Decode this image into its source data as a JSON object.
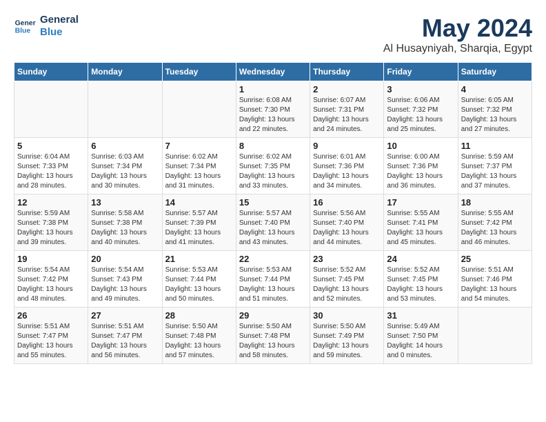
{
  "logo": {
    "line1": "General",
    "line2": "Blue"
  },
  "title": "May 2024",
  "subtitle": "Al Husayniyah, Sharqia, Egypt",
  "days_of_week": [
    "Sunday",
    "Monday",
    "Tuesday",
    "Wednesday",
    "Thursday",
    "Friday",
    "Saturday"
  ],
  "weeks": [
    [
      {
        "day": "",
        "sunrise": "",
        "sunset": "",
        "daylight": ""
      },
      {
        "day": "",
        "sunrise": "",
        "sunset": "",
        "daylight": ""
      },
      {
        "day": "",
        "sunrise": "",
        "sunset": "",
        "daylight": ""
      },
      {
        "day": "1",
        "sunrise": "Sunrise: 6:08 AM",
        "sunset": "Sunset: 7:30 PM",
        "daylight": "Daylight: 13 hours and 22 minutes."
      },
      {
        "day": "2",
        "sunrise": "Sunrise: 6:07 AM",
        "sunset": "Sunset: 7:31 PM",
        "daylight": "Daylight: 13 hours and 24 minutes."
      },
      {
        "day": "3",
        "sunrise": "Sunrise: 6:06 AM",
        "sunset": "Sunset: 7:32 PM",
        "daylight": "Daylight: 13 hours and 25 minutes."
      },
      {
        "day": "4",
        "sunrise": "Sunrise: 6:05 AM",
        "sunset": "Sunset: 7:32 PM",
        "daylight": "Daylight: 13 hours and 27 minutes."
      }
    ],
    [
      {
        "day": "5",
        "sunrise": "Sunrise: 6:04 AM",
        "sunset": "Sunset: 7:33 PM",
        "daylight": "Daylight: 13 hours and 28 minutes."
      },
      {
        "day": "6",
        "sunrise": "Sunrise: 6:03 AM",
        "sunset": "Sunset: 7:34 PM",
        "daylight": "Daylight: 13 hours and 30 minutes."
      },
      {
        "day": "7",
        "sunrise": "Sunrise: 6:02 AM",
        "sunset": "Sunset: 7:34 PM",
        "daylight": "Daylight: 13 hours and 31 minutes."
      },
      {
        "day": "8",
        "sunrise": "Sunrise: 6:02 AM",
        "sunset": "Sunset: 7:35 PM",
        "daylight": "Daylight: 13 hours and 33 minutes."
      },
      {
        "day": "9",
        "sunrise": "Sunrise: 6:01 AM",
        "sunset": "Sunset: 7:36 PM",
        "daylight": "Daylight: 13 hours and 34 minutes."
      },
      {
        "day": "10",
        "sunrise": "Sunrise: 6:00 AM",
        "sunset": "Sunset: 7:36 PM",
        "daylight": "Daylight: 13 hours and 36 minutes."
      },
      {
        "day": "11",
        "sunrise": "Sunrise: 5:59 AM",
        "sunset": "Sunset: 7:37 PM",
        "daylight": "Daylight: 13 hours and 37 minutes."
      }
    ],
    [
      {
        "day": "12",
        "sunrise": "Sunrise: 5:59 AM",
        "sunset": "Sunset: 7:38 PM",
        "daylight": "Daylight: 13 hours and 39 minutes."
      },
      {
        "day": "13",
        "sunrise": "Sunrise: 5:58 AM",
        "sunset": "Sunset: 7:38 PM",
        "daylight": "Daylight: 13 hours and 40 minutes."
      },
      {
        "day": "14",
        "sunrise": "Sunrise: 5:57 AM",
        "sunset": "Sunset: 7:39 PM",
        "daylight": "Daylight: 13 hours and 41 minutes."
      },
      {
        "day": "15",
        "sunrise": "Sunrise: 5:57 AM",
        "sunset": "Sunset: 7:40 PM",
        "daylight": "Daylight: 13 hours and 43 minutes."
      },
      {
        "day": "16",
        "sunrise": "Sunrise: 5:56 AM",
        "sunset": "Sunset: 7:40 PM",
        "daylight": "Daylight: 13 hours and 44 minutes."
      },
      {
        "day": "17",
        "sunrise": "Sunrise: 5:55 AM",
        "sunset": "Sunset: 7:41 PM",
        "daylight": "Daylight: 13 hours and 45 minutes."
      },
      {
        "day": "18",
        "sunrise": "Sunrise: 5:55 AM",
        "sunset": "Sunset: 7:42 PM",
        "daylight": "Daylight: 13 hours and 46 minutes."
      }
    ],
    [
      {
        "day": "19",
        "sunrise": "Sunrise: 5:54 AM",
        "sunset": "Sunset: 7:42 PM",
        "daylight": "Daylight: 13 hours and 48 minutes."
      },
      {
        "day": "20",
        "sunrise": "Sunrise: 5:54 AM",
        "sunset": "Sunset: 7:43 PM",
        "daylight": "Daylight: 13 hours and 49 minutes."
      },
      {
        "day": "21",
        "sunrise": "Sunrise: 5:53 AM",
        "sunset": "Sunset: 7:44 PM",
        "daylight": "Daylight: 13 hours and 50 minutes."
      },
      {
        "day": "22",
        "sunrise": "Sunrise: 5:53 AM",
        "sunset": "Sunset: 7:44 PM",
        "daylight": "Daylight: 13 hours and 51 minutes."
      },
      {
        "day": "23",
        "sunrise": "Sunrise: 5:52 AM",
        "sunset": "Sunset: 7:45 PM",
        "daylight": "Daylight: 13 hours and 52 minutes."
      },
      {
        "day": "24",
        "sunrise": "Sunrise: 5:52 AM",
        "sunset": "Sunset: 7:45 PM",
        "daylight": "Daylight: 13 hours and 53 minutes."
      },
      {
        "day": "25",
        "sunrise": "Sunrise: 5:51 AM",
        "sunset": "Sunset: 7:46 PM",
        "daylight": "Daylight: 13 hours and 54 minutes."
      }
    ],
    [
      {
        "day": "26",
        "sunrise": "Sunrise: 5:51 AM",
        "sunset": "Sunset: 7:47 PM",
        "daylight": "Daylight: 13 hours and 55 minutes."
      },
      {
        "day": "27",
        "sunrise": "Sunrise: 5:51 AM",
        "sunset": "Sunset: 7:47 PM",
        "daylight": "Daylight: 13 hours and 56 minutes."
      },
      {
        "day": "28",
        "sunrise": "Sunrise: 5:50 AM",
        "sunset": "Sunset: 7:48 PM",
        "daylight": "Daylight: 13 hours and 57 minutes."
      },
      {
        "day": "29",
        "sunrise": "Sunrise: 5:50 AM",
        "sunset": "Sunset: 7:48 PM",
        "daylight": "Daylight: 13 hours and 58 minutes."
      },
      {
        "day": "30",
        "sunrise": "Sunrise: 5:50 AM",
        "sunset": "Sunset: 7:49 PM",
        "daylight": "Daylight: 13 hours and 59 minutes."
      },
      {
        "day": "31",
        "sunrise": "Sunrise: 5:49 AM",
        "sunset": "Sunset: 7:50 PM",
        "daylight": "Daylight: 14 hours and 0 minutes."
      },
      {
        "day": "",
        "sunrise": "",
        "sunset": "",
        "daylight": ""
      }
    ]
  ]
}
